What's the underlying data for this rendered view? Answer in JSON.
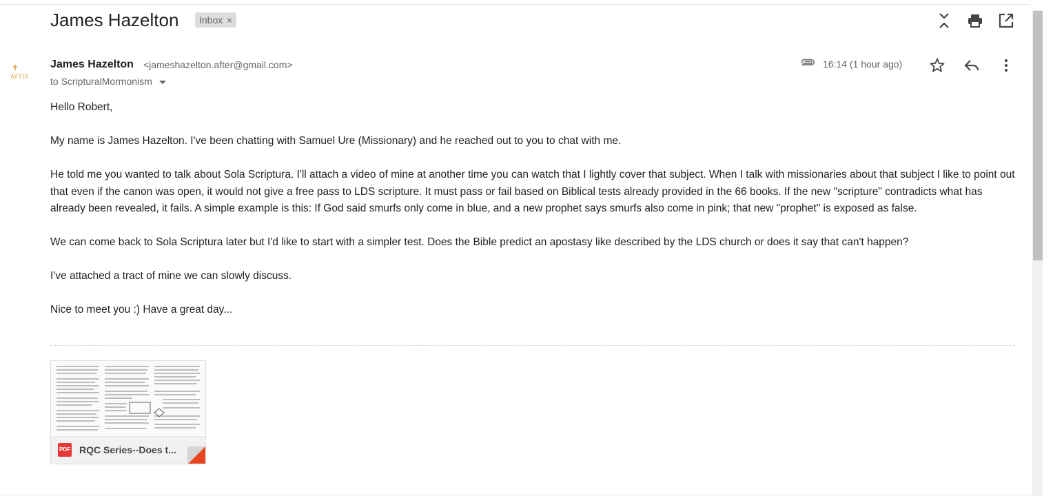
{
  "email": {
    "subject": "James Hazelton",
    "label": "Inbox",
    "label_remove": "×",
    "sender": {
      "name": "James Hazelton",
      "email": "<jameshazelton.after@gmail.com>",
      "avatar_text": "AFTER"
    },
    "to": "to ScripturalMormonism",
    "time": "16:14 (1 hour ago)",
    "body": [
      "Hello Robert,",
      "My name is James Hazelton.  I've been chatting with Samuel Ure (Missionary) and he reached out to you to chat with me.",
      "He told me you wanted to talk about Sola Scriptura.  I'll attach a video of mine at another time you can watch that I lightly cover that subject.  When I talk with missionaries about that subject I like to point out that even if the canon was open, it would not give a free pass to LDS scripture.  It must pass or fail based on Biblical tests already provided in the 66 books.  If the new \"scripture\" contradicts what has already been revealed, it fails.  A simple example is this:  If God said smurfs only come in blue, and a new prophet says smurfs also come in pink; that new \"prophet\" is exposed as false.",
      "We can come back to Sola Scriptura later but I'd like to start with a simpler test.  Does the Bible predict an apostasy like described by the LDS church or does it say that can't happen?",
      "I've attached a tract of mine we can slowly discuss.",
      "Nice to meet you :)  Have a great day..."
    ],
    "attachment": {
      "type_badge": "PDF",
      "name": "RQC Series--Does t..."
    }
  },
  "icons": {
    "collapse": "collapse-all-icon",
    "print": "print-icon",
    "open_new_window": "open-in-new-window-icon",
    "attachment": "paperclip-icon",
    "star": "star-icon",
    "reply": "reply-icon",
    "more": "more-vert-icon"
  },
  "colors": {
    "pdf_red": "#e53935",
    "chip_bg": "#dddddd",
    "secondary_text": "#5f6368"
  }
}
